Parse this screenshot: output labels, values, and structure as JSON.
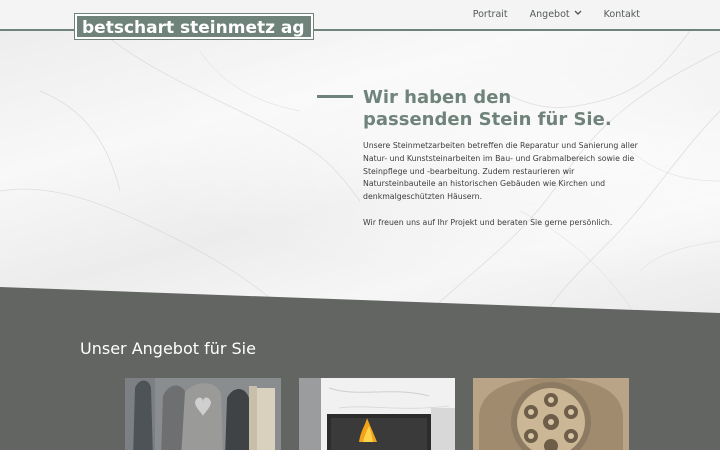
{
  "header": {
    "logo_text": "betschart steinmetz ag",
    "nav": [
      {
        "label": "Portrait"
      },
      {
        "label": "Angebot",
        "has_dropdown": true
      },
      {
        "label": "Kontakt"
      }
    ]
  },
  "hero": {
    "headline_line1": "Wir haben den",
    "headline_line2": "passenden Stein für Sie.",
    "paragraph1": "Unsere Steinmetzarbeiten betreffen die Reparatur und Sanierung aller Natur- und Kunststeinarbeiten im Bau- und Grabmalbereich sowie die Steinpflege und -bearbeitung. Zudem restaurieren wir Natursteinbauteile an historischen Gebäuden wie Kirchen und denkmalgeschützten Häusern.",
    "paragraph2": "Wir freuen uns auf Ihr Projekt und beraten Sie gerne persönlich."
  },
  "offers": {
    "title": "Unser Angebot für Sie"
  },
  "colors": {
    "brand": "#6f837a",
    "dark_section": "#626562",
    "text": "#3d3d3d"
  },
  "icons": {
    "dropdown": "chevron-down-icon"
  }
}
